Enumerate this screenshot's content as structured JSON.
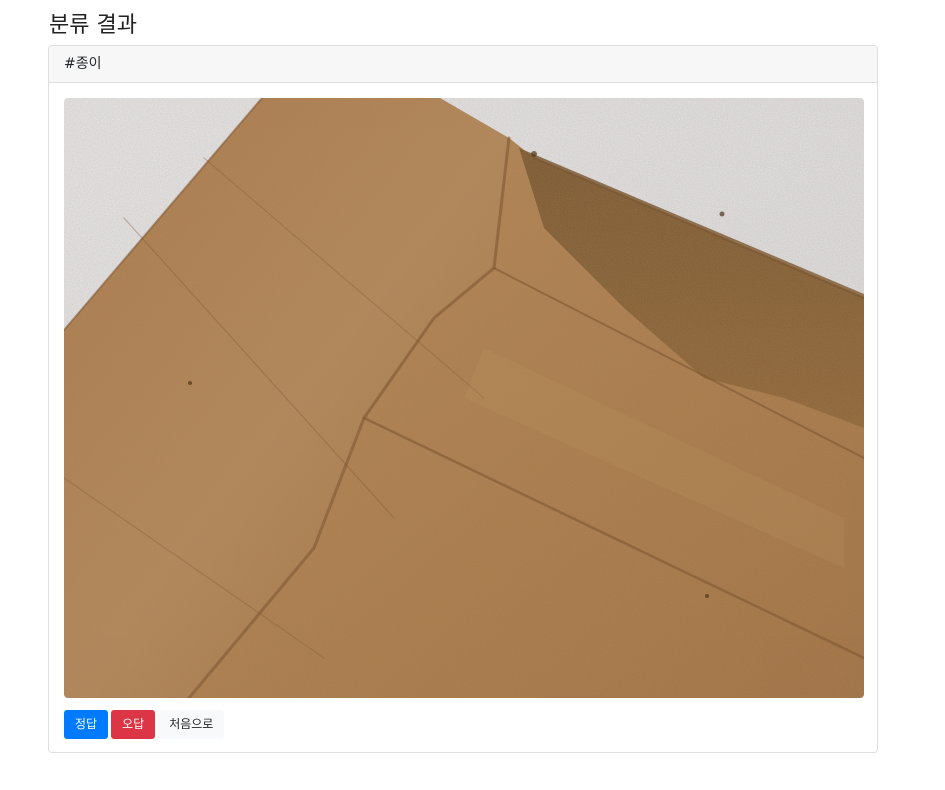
{
  "page": {
    "title": "분류 결과"
  },
  "result": {
    "tag": "#종이",
    "image_alt": "종이"
  },
  "actions": {
    "correct_label": "정답",
    "wrong_label": "오답",
    "home_label": "처음으로"
  },
  "colors": {
    "primary": "#007bff",
    "danger": "#dc3545",
    "light": "#f8f9fa",
    "cardboard": "#a87a4a",
    "background_wall": "#e9eaee"
  }
}
